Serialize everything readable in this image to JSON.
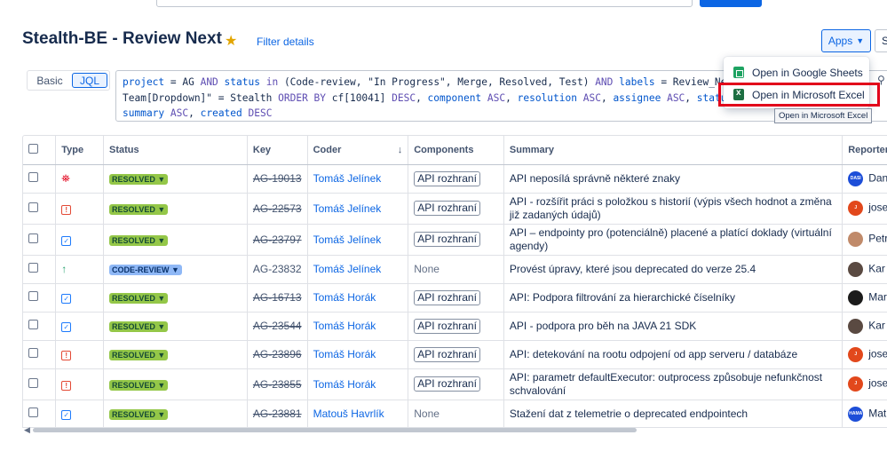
{
  "header": {
    "title": "Stealth-BE - Review Next",
    "filter_details": "Filter details",
    "apps_label": "Apps",
    "s_label": "S"
  },
  "query_mode": {
    "basic": "Basic",
    "jql": "JQL",
    "selected": "JQL"
  },
  "jql": {
    "line1": "project = AG AND status in (Code-review, \"In Progress\", Merge, Resolved, Test) AND labels = Review_Next",
    "line2": "Team[Dropdown]\" = Stealth ORDER BY cf[10041] DESC, component ASC, resolution ASC, assignee ASC, status",
    "line3": "summary ASC, created DESC"
  },
  "apps_menu": {
    "items": [
      {
        "label": "Open in Google Sheets",
        "icon": "google-sheets-icon"
      },
      {
        "label": "Open in Microsoft Excel",
        "icon": "excel-icon"
      }
    ],
    "tooltip": "Open in Microsoft Excel"
  },
  "table": {
    "columns": [
      "Type",
      "Status",
      "Key",
      "Coder",
      "Components",
      "Summary",
      "Reporter"
    ],
    "rows": [
      {
        "type": "bug",
        "status": "RESOLVED",
        "key": "AG-19013",
        "coder": "Tomáš Jelínek",
        "component": "API rozhraní",
        "summary": "API neposílá správně některé znaky",
        "reporter": "Dan",
        "reporter_avatar": "DASI",
        "avatar_color": "#1d4ed8"
      },
      {
        "type": "incident",
        "status": "RESOLVED",
        "key": "AG-22573",
        "coder": "Tomáš Jelínek",
        "component": "API rozhraní",
        "summary": "API - rozšířit práci s položkou s historií (výpis všech hodnot a změna již zadaných údajů)",
        "reporter": "jose",
        "reporter_avatar": "J",
        "avatar_color": "#e2481c"
      },
      {
        "type": "task",
        "status": "RESOLVED",
        "key": "AG-23797",
        "coder": "Tomáš Jelínek",
        "component": "API rozhraní",
        "summary": "API – endpointy pro (potenciálně) placené a platící doklady (virtuální agendy)",
        "reporter": "Petr",
        "reporter_avatar": "",
        "avatar_color": "#c08a6a"
      },
      {
        "type": "improvement",
        "status": "CODE-REVIEW",
        "key": "AG-23832",
        "coder": "Tomáš Jelínek",
        "component": "None",
        "summary": "Provést úpravy, které jsou deprecated do verze 25.4",
        "reporter": "Kar",
        "reporter_avatar": "",
        "avatar_color": "#5a4a42"
      },
      {
        "type": "task",
        "status": "RESOLVED",
        "key": "AG-16713",
        "coder": "Tomáš Horák",
        "component": "API rozhraní",
        "summary": "API: Podpora filtrování za hierarchické číselníky",
        "reporter": "Mar",
        "reporter_avatar": "",
        "avatar_color": "#1b1b1b"
      },
      {
        "type": "task",
        "status": "RESOLVED",
        "key": "AG-23544",
        "coder": "Tomáš Horák",
        "component": "API rozhraní",
        "summary": "API - podpora pro běh na JAVA 21 SDK",
        "reporter": "Kar",
        "reporter_avatar": "",
        "avatar_color": "#5a4a42"
      },
      {
        "type": "incident",
        "status": "RESOLVED",
        "key": "AG-23896",
        "coder": "Tomáš Horák",
        "component": "API rozhraní",
        "summary": "API: detekování na rootu odpojení od app serveru / databáze",
        "reporter": "jose",
        "reporter_avatar": "J",
        "avatar_color": "#e2481c"
      },
      {
        "type": "incident",
        "status": "RESOLVED",
        "key": "AG-23855",
        "coder": "Tomáš Horák",
        "component": "API rozhraní",
        "summary": "API: parametr defaultExecutor: outprocess způsobuje nefunkčnost schvalování",
        "reporter": "jose",
        "reporter_avatar": "J",
        "avatar_color": "#e2481c"
      },
      {
        "type": "task",
        "status": "RESOLVED",
        "key": "AG-23881",
        "coder": "Matouš Havrlík",
        "component": "None",
        "summary": "Stažení dat z telemetrie o deprecated endpointech",
        "reporter": "Mat",
        "reporter_avatar": "HAMA",
        "avatar_color": "#1d4ed8"
      }
    ]
  },
  "colors": {
    "accent": "#0c66e4",
    "resolved": "#94c748",
    "code_review": "#8fb8f6",
    "highlight": "#e2001a"
  }
}
